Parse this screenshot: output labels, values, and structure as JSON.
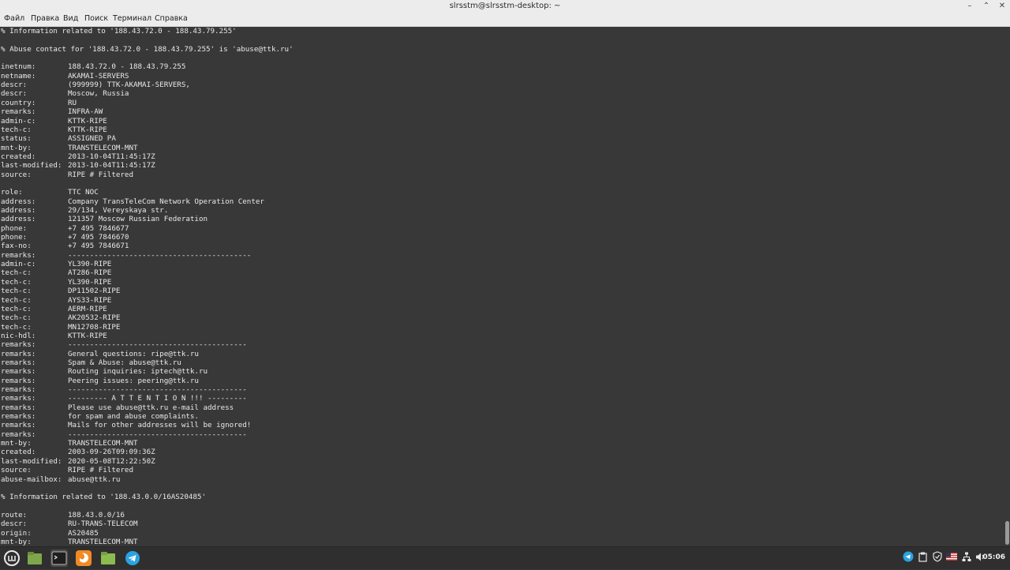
{
  "window": {
    "title": "slrsstm@slrsstm-desktop: ~",
    "minimize_icon": "minimize-icon",
    "maximize_icon": "maximize-icon",
    "close_icon": "close-icon"
  },
  "menu": {
    "file": "Файл",
    "edit": "Правка",
    "view": "Вид",
    "search": "Поиск",
    "terminal": "Терминал",
    "help": "Справка"
  },
  "terminal": {
    "lines": [
      {
        "key": "% Information related to '188.43.72.0 - 188.43.79.255'",
        "val": ""
      },
      {
        "key": "",
        "val": ""
      },
      {
        "key": "% Abuse contact for '188.43.72.0 - 188.43.79.255' is 'abuse@ttk.ru'",
        "val": ""
      },
      {
        "key": "",
        "val": ""
      },
      {
        "key": "inetnum:",
        "val": "188.43.72.0 - 188.43.79.255"
      },
      {
        "key": "netname:",
        "val": "AKAMAI-SERVERS"
      },
      {
        "key": "descr:",
        "val": "(999999) TTK-AKAMAI-SERVERS,"
      },
      {
        "key": "descr:",
        "val": "Moscow, Russia"
      },
      {
        "key": "country:",
        "val": "RU"
      },
      {
        "key": "remarks:",
        "val": "INFRA-AW"
      },
      {
        "key": "admin-c:",
        "val": "KTTK-RIPE"
      },
      {
        "key": "tech-c:",
        "val": "KTTK-RIPE"
      },
      {
        "key": "status:",
        "val": "ASSIGNED PA"
      },
      {
        "key": "mnt-by:",
        "val": "TRANSTELECOM-MNT"
      },
      {
        "key": "created:",
        "val": "2013-10-04T11:45:17Z"
      },
      {
        "key": "last-modified:",
        "val": "2013-10-04T11:45:17Z"
      },
      {
        "key": "source:",
        "val": "RIPE # Filtered"
      },
      {
        "key": "",
        "val": ""
      },
      {
        "key": "role:",
        "val": "TTC NOC"
      },
      {
        "key": "address:",
        "val": "Company TransTeleCom Network Operation Center"
      },
      {
        "key": "address:",
        "val": "29/134, Vereyskaya str."
      },
      {
        "key": "address:",
        "val": "121357 Moscow Russian Federation"
      },
      {
        "key": "phone:",
        "val": "+7 495 7846677"
      },
      {
        "key": "phone:",
        "val": "+7 495 7846670"
      },
      {
        "key": "fax-no:",
        "val": "+7 495 7846671"
      },
      {
        "key": "remarks:",
        "val": "------------------------------------------"
      },
      {
        "key": "admin-c:",
        "val": "YL390-RIPE"
      },
      {
        "key": "tech-c:",
        "val": "AT286-RIPE"
      },
      {
        "key": "tech-c:",
        "val": "YL390-RIPE"
      },
      {
        "key": "tech-c:",
        "val": "DP11502-RIPE"
      },
      {
        "key": "tech-c:",
        "val": "AYS33-RIPE"
      },
      {
        "key": "tech-c:",
        "val": "AERM-RIPE"
      },
      {
        "key": "tech-c:",
        "val": "AK20532-RIPE"
      },
      {
        "key": "tech-c:",
        "val": "MN12708-RIPE"
      },
      {
        "key": "nic-hdl:",
        "val": "KTTK-RIPE"
      },
      {
        "key": "remarks:",
        "val": "-----------------------------------------"
      },
      {
        "key": "remarks:",
        "val": "General questions: ripe@ttk.ru"
      },
      {
        "key": "remarks:",
        "val": "Spam & Abuse: abuse@ttk.ru"
      },
      {
        "key": "remarks:",
        "val": "Routing inquiries: iptech@ttk.ru"
      },
      {
        "key": "remarks:",
        "val": "Peering issues: peering@ttk.ru"
      },
      {
        "key": "remarks:",
        "val": "-----------------------------------------"
      },
      {
        "key": "remarks:",
        "val": "--------- A T T E N T I O N !!! ---------"
      },
      {
        "key": "remarks:",
        "val": "Please use abuse@ttk.ru e-mail address"
      },
      {
        "key": "remarks:",
        "val": "for spam and abuse complaints."
      },
      {
        "key": "remarks:",
        "val": "Mails for other addresses will be ignored!"
      },
      {
        "key": "remarks:",
        "val": "-----------------------------------------"
      },
      {
        "key": "mnt-by:",
        "val": "TRANSTELECOM-MNT"
      },
      {
        "key": "created:",
        "val": "2003-09-26T09:09:36Z"
      },
      {
        "key": "last-modified:",
        "val": "2020-05-08T12:22:50Z"
      },
      {
        "key": "source:",
        "val": "RIPE # Filtered"
      },
      {
        "key": "abuse-mailbox:",
        "val": "abuse@ttk.ru"
      },
      {
        "key": "",
        "val": ""
      },
      {
        "key": "% Information related to '188.43.0.0/16AS20485'",
        "val": ""
      },
      {
        "key": "",
        "val": ""
      },
      {
        "key": "route:",
        "val": "188.43.0.0/16"
      },
      {
        "key": "descr:",
        "val": "RU-TRANS-TELECOM"
      },
      {
        "key": "origin:",
        "val": "AS20485"
      },
      {
        "key": "mnt-by:",
        "val": "TRANSTELECOM-MNT"
      }
    ]
  },
  "taskbar": {
    "apps": [
      "mint-menu-icon",
      "files-icon",
      "terminal-icon",
      "firefox-icon",
      "folder-icon",
      "telegram-icon"
    ],
    "tray": [
      "telegram-tray-icon",
      "clipboard-icon",
      "update-shield-icon",
      "us-flag-icon",
      "network-icon",
      "volume-icon"
    ],
    "clock": "05:06"
  }
}
